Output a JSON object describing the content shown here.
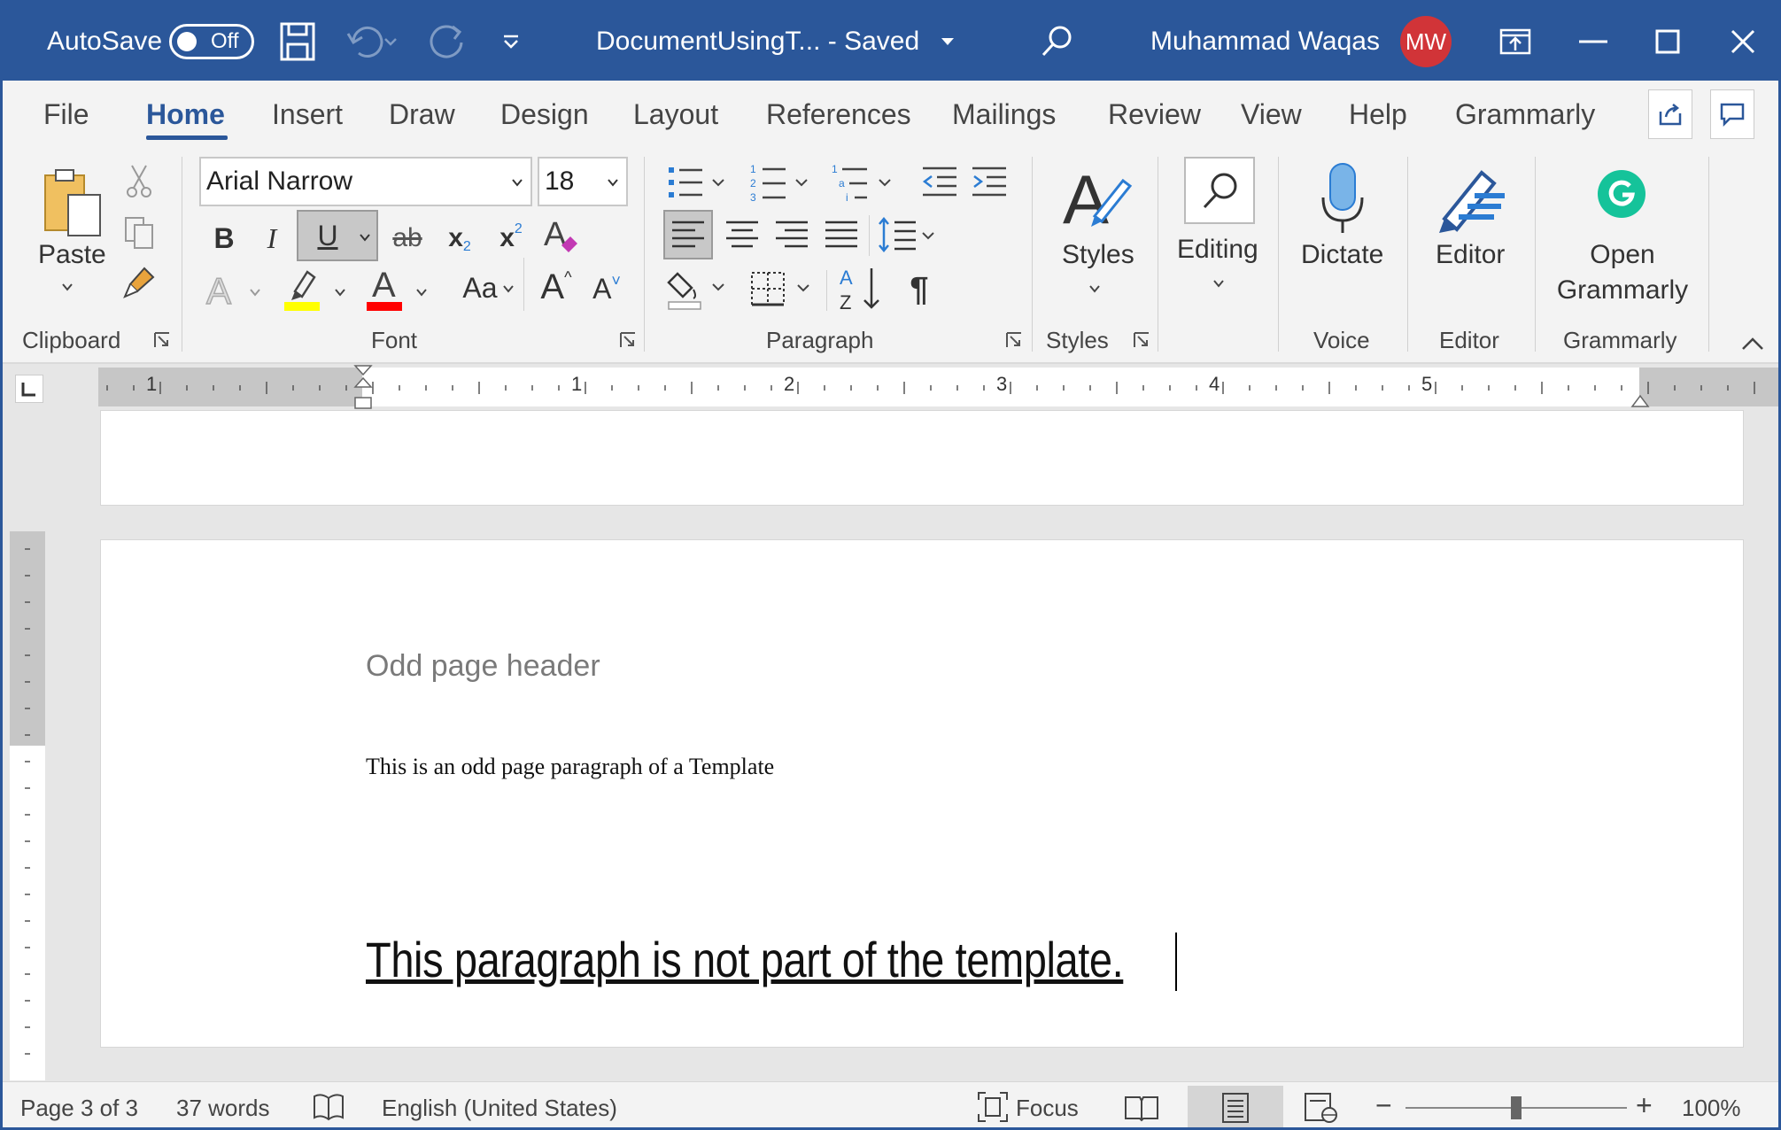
{
  "titlebar": {
    "autosave_label": "AutoSave",
    "autosave_state": "Off",
    "doc_title": "DocumentUsingT...  -  Saved",
    "user_name": "Muhammad Waqas",
    "user_initials": "MW"
  },
  "tabs": [
    "File",
    "Home",
    "Insert",
    "Draw",
    "Design",
    "Layout",
    "References",
    "Mailings",
    "Review",
    "View",
    "Help",
    "Grammarly"
  ],
  "active_tab": "Home",
  "ribbon": {
    "clipboard": {
      "paste": "Paste",
      "group": "Clipboard"
    },
    "font": {
      "name": "Arial Narrow",
      "size": "18",
      "group": "Font",
      "bold": "B",
      "italic": "I",
      "underline": "U",
      "strike": "ab",
      "subscript": "x",
      "superscript": "x",
      "case": "Aa",
      "grow": "A",
      "shrink": "A"
    },
    "paragraph": {
      "group": "Paragraph"
    },
    "styles": {
      "label": "Styles",
      "group": "Styles"
    },
    "editing": {
      "label": "Editing"
    },
    "voice": {
      "label": "Dictate",
      "group": "Voice"
    },
    "editor": {
      "label": "Editor",
      "group": "Editor"
    },
    "grammarly": {
      "label1": "Open",
      "label2": "Grammarly",
      "group": "Grammarly"
    }
  },
  "ruler": {
    "numbers": [
      "1",
      "1",
      "2",
      "3",
      "4",
      "5"
    ]
  },
  "document": {
    "header": "Odd page header",
    "para1": "This is an odd page paragraph of a Template",
    "para2": "This paragraph is not part of the template."
  },
  "status": {
    "page": "Page 3 of 3",
    "words": "37 words",
    "language": "English (United States)",
    "focus": "Focus",
    "zoom": "100%",
    "zoom_level": 1.0
  },
  "colors": {
    "brand": "#2b579a",
    "highlight": "#ffff00",
    "font_color": "#ff0000",
    "grammarly": "#15c39a",
    "avatar": "#d13438"
  }
}
